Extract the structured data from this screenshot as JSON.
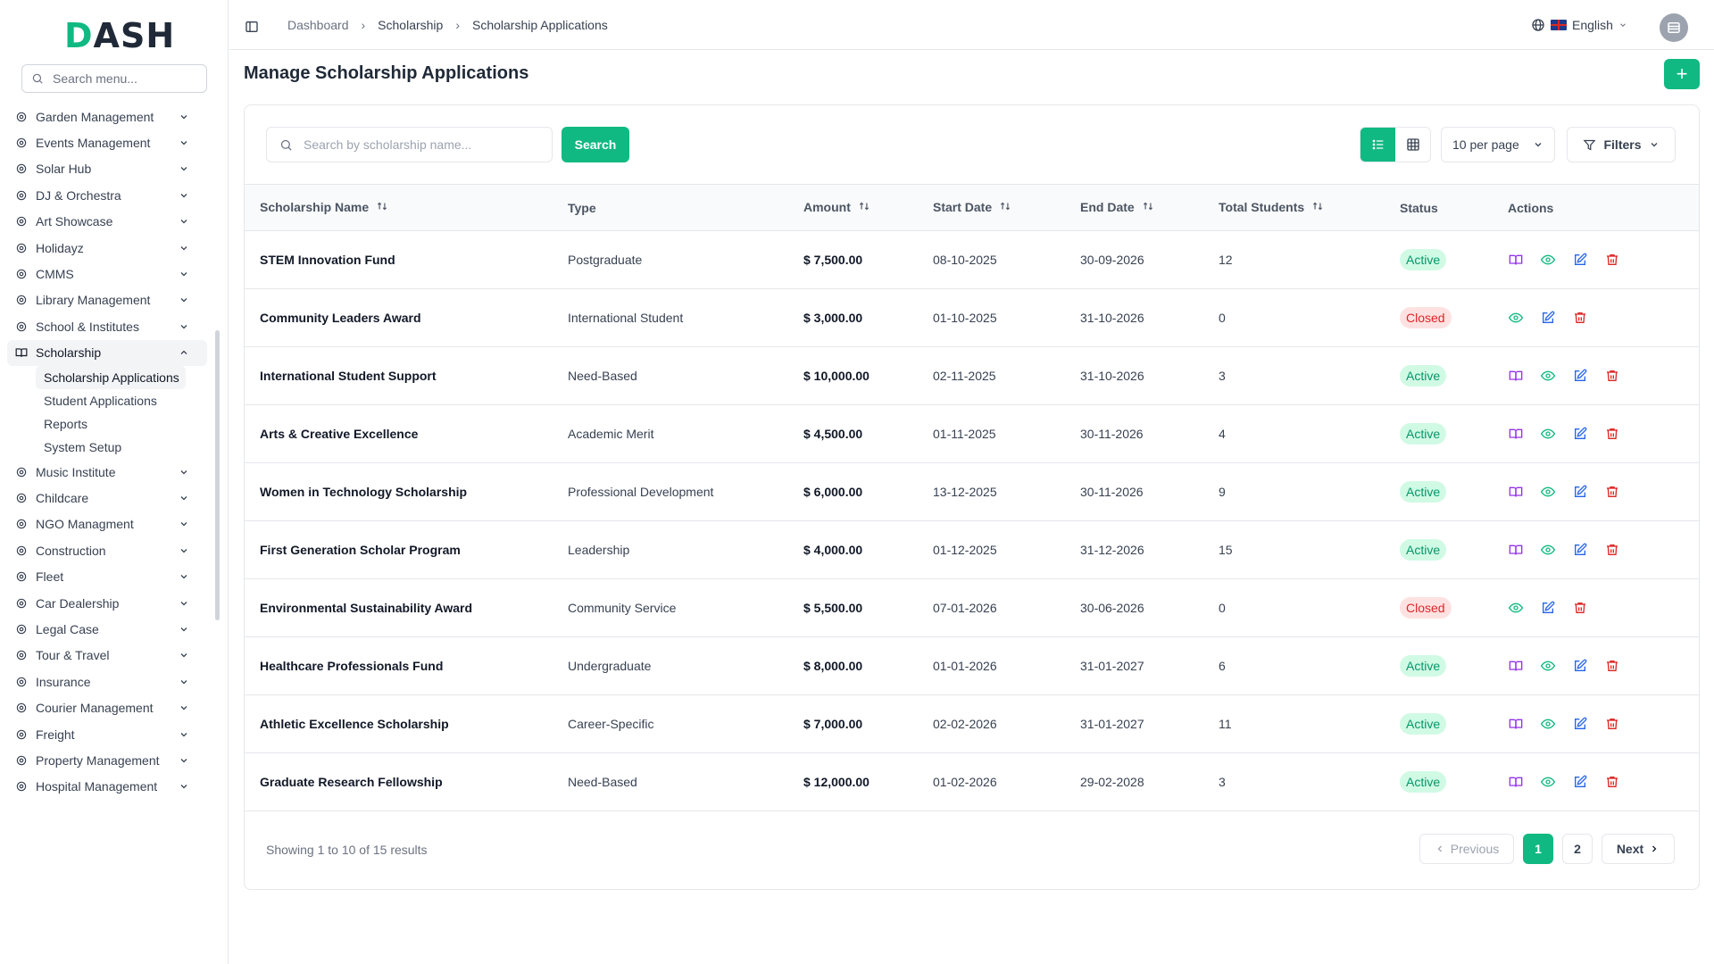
{
  "app": {
    "logo_text": "DASH",
    "search_placeholder": "Search menu..."
  },
  "sidebar": {
    "items": [
      {
        "label": "Garden Management",
        "icon": "sprout-icon"
      },
      {
        "label": "Events Management",
        "icon": "party-icon"
      },
      {
        "label": "Solar Hub",
        "icon": "bolt-icon"
      },
      {
        "label": "DJ & Orchestra",
        "icon": "disc-icon"
      },
      {
        "label": "Art Showcase",
        "icon": "palette-icon"
      },
      {
        "label": "Holidayz",
        "icon": "beach-icon"
      },
      {
        "label": "CMMS",
        "icon": "cog-icon"
      },
      {
        "label": "Library Management",
        "icon": "library-icon"
      },
      {
        "label": "School & Institutes",
        "icon": "school-icon"
      },
      {
        "label": "Scholarship",
        "icon": "book-open-icon"
      }
    ],
    "scholarship_sub": [
      {
        "label": "Scholarship Applications"
      },
      {
        "label": "Student Applications"
      },
      {
        "label": "Reports"
      },
      {
        "label": "System Setup"
      }
    ],
    "items_after": [
      {
        "label": "Music Institute",
        "icon": "music-icon"
      },
      {
        "label": "Childcare",
        "icon": "baby-icon"
      },
      {
        "label": "NGO Managment",
        "icon": "handshake-icon"
      },
      {
        "label": "Construction",
        "icon": "crane-icon"
      },
      {
        "label": "Fleet",
        "icon": "car-icon"
      },
      {
        "label": "Car Dealership",
        "icon": "car-front-icon"
      },
      {
        "label": "Legal Case",
        "icon": "scale-icon"
      },
      {
        "label": "Tour & Travel",
        "icon": "plane-icon"
      },
      {
        "label": "Insurance",
        "icon": "shield-icon"
      },
      {
        "label": "Courier Management",
        "icon": "truck-icon"
      },
      {
        "label": "Freight",
        "icon": "container-icon"
      },
      {
        "label": "Property Management",
        "icon": "building-icon"
      },
      {
        "label": "Hospital Management",
        "icon": "stethoscope-icon"
      }
    ]
  },
  "header": {
    "breadcrumbs": [
      "Dashboard",
      "Scholarship",
      "Scholarship Applications"
    ],
    "language": "English"
  },
  "page": {
    "title": "Manage Scholarship Applications",
    "add_label": "+"
  },
  "toolbar": {
    "search_placeholder": "Search by scholarship name...",
    "search_label": "Search",
    "per_page": "10 per page",
    "filters_label": "Filters"
  },
  "table": {
    "columns": [
      "Scholarship Name",
      "Type",
      "Amount",
      "Start Date",
      "End Date",
      "Total Students",
      "Status",
      "Actions"
    ],
    "rows": [
      {
        "name": "STEM Innovation Fund",
        "type": "Postgraduate",
        "amount": "$ 7,500.00",
        "start": "08-10-2025",
        "end": "30-09-2026",
        "students": "12",
        "status": "Active"
      },
      {
        "name": "Community Leaders Award",
        "type": "International Student",
        "amount": "$ 3,000.00",
        "start": "01-10-2025",
        "end": "31-10-2026",
        "students": "0",
        "status": "Closed"
      },
      {
        "name": "International Student Support",
        "type": "Need-Based",
        "amount": "$ 10,000.00",
        "start": "02-11-2025",
        "end": "31-10-2026",
        "students": "3",
        "status": "Active"
      },
      {
        "name": "Arts & Creative Excellence",
        "type": "Academic Merit",
        "amount": "$ 4,500.00",
        "start": "01-11-2025",
        "end": "30-11-2026",
        "students": "4",
        "status": "Active"
      },
      {
        "name": "Women in Technology Scholarship",
        "type": "Professional Development",
        "amount": "$ 6,000.00",
        "start": "13-12-2025",
        "end": "30-11-2026",
        "students": "9",
        "status": "Active"
      },
      {
        "name": "First Generation Scholar Program",
        "type": "Leadership",
        "amount": "$ 4,000.00",
        "start": "01-12-2025",
        "end": "31-12-2026",
        "students": "15",
        "status": "Active"
      },
      {
        "name": "Environmental Sustainability Award",
        "type": "Community Service",
        "amount": "$ 5,500.00",
        "start": "07-01-2026",
        "end": "30-06-2026",
        "students": "0",
        "status": "Closed"
      },
      {
        "name": "Healthcare Professionals Fund",
        "type": "Undergraduate",
        "amount": "$ 8,000.00",
        "start": "01-01-2026",
        "end": "31-01-2027",
        "students": "6",
        "status": "Active"
      },
      {
        "name": "Athletic Excellence Scholarship",
        "type": "Career-Specific",
        "amount": "$ 7,000.00",
        "start": "02-02-2026",
        "end": "31-01-2027",
        "students": "11",
        "status": "Active"
      },
      {
        "name": "Graduate Research Fellowship",
        "type": "Need-Based",
        "amount": "$ 12,000.00",
        "start": "01-02-2026",
        "end": "29-02-2028",
        "students": "3",
        "status": "Active"
      }
    ]
  },
  "footer": {
    "showing": "Showing 1 to 10 of 15 results",
    "prev": "Previous",
    "pages": [
      "1",
      "2"
    ],
    "next": "Next"
  },
  "colors": {
    "accent": "#10b981",
    "active_bg": "#d1fae5",
    "closed_bg": "#fee2e2",
    "apply_icon": "#9333ea",
    "view_icon": "#10b981",
    "edit_icon": "#2563eb",
    "delete_icon": "#dc2626"
  }
}
